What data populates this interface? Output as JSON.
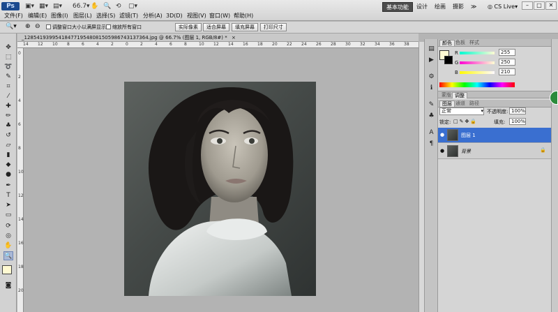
{
  "app": {
    "icon_text": "Ps",
    "zoom_widget": "66.7",
    "workspaces": [
      "基本功能",
      "设计",
      "绘画",
      "摄影"
    ],
    "more": "≫",
    "cslive": "CS Live",
    "window_controls": [
      "–",
      "□",
      "✕"
    ]
  },
  "menu": [
    "文件(F)",
    "编辑(E)",
    "图像(I)",
    "图层(L)",
    "选择(S)",
    "滤镜(T)",
    "分析(A)",
    "3D(D)",
    "视图(V)",
    "窗口(W)",
    "帮助(H)"
  ],
  "options": {
    "checkbox1": "调整窗口大小以满屏显示",
    "checkbox2": "缩放所有窗口",
    "btn_actual": "实际像素",
    "btn_fit": "适合屏幕",
    "btn_fill": "填充屏幕",
    "btn_print": "打印尺寸"
  },
  "document": {
    "tab_title": "_1285419399541847719548081505986743137364.jpg @ 66.7% (图层 1, RGB/8#) *",
    "close": "×",
    "ruler_h": [
      "14",
      "12",
      "10",
      "8",
      "6",
      "4",
      "2",
      "0",
      "2",
      "4",
      "6",
      "8",
      "10",
      "12",
      "14",
      "16",
      "18",
      "20",
      "22",
      "24",
      "26",
      "28",
      "30",
      "32",
      "34",
      "36",
      "38"
    ],
    "ruler_v": [
      "0",
      "2",
      "4",
      "6",
      "8",
      "10",
      "12",
      "14",
      "16",
      "18",
      "20"
    ]
  },
  "color_panel": {
    "tabs": [
      "颜色",
      "色板",
      "样式"
    ],
    "r_label": "R",
    "g_label": "G",
    "b_label": "B",
    "r_value": "255",
    "g_value": "250",
    "b_value": "210",
    "foreground": "#fffad2"
  },
  "adjust_panel": {
    "tabs": [
      "蒙版",
      "调整"
    ]
  },
  "layers_panel": {
    "tabs": [
      "图层",
      "通道",
      "路径"
    ],
    "blend_mode": "正常",
    "opacity_label": "不透明度:",
    "opacity_value": "100%",
    "lock_label": "锁定:",
    "fill_label": "填充:",
    "fill_value": "100%",
    "layers": [
      {
        "name": "图层 1",
        "selected": true
      },
      {
        "name": "背景",
        "selected": false,
        "locked": true
      }
    ]
  },
  "colors": {
    "selected_layer": "#3a6fd0",
    "accent": "#2a8a3a"
  }
}
